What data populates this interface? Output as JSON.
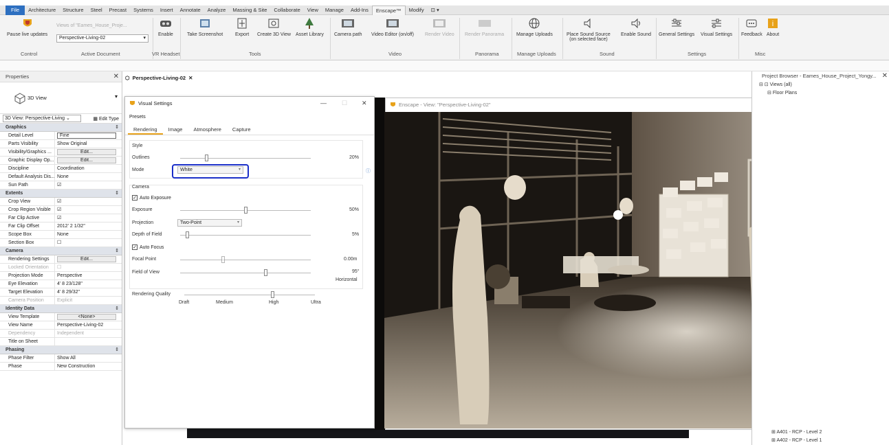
{
  "menu_tabs": [
    "File",
    "Architecture",
    "Structure",
    "Steel",
    "Precast",
    "Systems",
    "Insert",
    "Annotate",
    "Analyze",
    "Massing & Site",
    "Collaborate",
    "View",
    "Manage",
    "Add-Ins",
    "Enscape™",
    "Modify",
    "⊡ ▾"
  ],
  "ribbon": {
    "pause_live": "Pause live updates",
    "doc_hint": "Views of \"Eames_House_Proje...",
    "doc_select": "Perspective-Living-02",
    "enable": "Enable",
    "take_screenshot": "Take Screenshot",
    "export": "Export",
    "create3d": "Create 3D View",
    "asset_library": "Asset Library",
    "camera_path": "Camera path",
    "video_editor": "Video Editor (on/off)",
    "render_video": "Render Video",
    "render_panorama": "Render Panorama",
    "manage_uploads": "Manage Uploads",
    "place_sound": "Place Sound Source",
    "place_sound_sub": "(on selected face)",
    "enable_sound": "Enable Sound",
    "general_settings": "General Settings",
    "visual_settings": "Visual Settings",
    "feedback": "Feedback",
    "about": "About",
    "groups": {
      "control": "Control",
      "active_doc": "Active Document",
      "vr": "VR Headset",
      "tools": "Tools",
      "video": "Video",
      "panorama": "Panorama",
      "manage_uploads": "Manage Uploads",
      "sound": "Sound",
      "settings": "Settings",
      "misc": "Misc"
    }
  },
  "properties": {
    "title": "Properties",
    "type_name": "3D View",
    "view_select": "3D View: Perspective-Living",
    "edit_type": "Edit Type",
    "sections": {
      "graphics": "Graphics",
      "extents": "Extents",
      "camera": "Camera",
      "identity": "Identity Data",
      "phasing": "Phasing"
    },
    "graphics_rows": [
      {
        "k": "Detail Level",
        "v": "Fine"
      },
      {
        "k": "Parts Visibility",
        "v": "Show Original"
      },
      {
        "k": "Visibility/Graphics ...",
        "v": "Edit..."
      },
      {
        "k": "Graphic Display Op...",
        "v": "Edit..."
      },
      {
        "k": "Discipline",
        "v": "Coordination"
      },
      {
        "k": "Default Analysis Dis...",
        "v": "None"
      },
      {
        "k": "Sun Path",
        "v": "☑"
      }
    ],
    "extents_rows": [
      {
        "k": "Crop View",
        "v": "☑"
      },
      {
        "k": "Crop Region Visible",
        "v": "☑"
      },
      {
        "k": "Far Clip Active",
        "v": "☑"
      },
      {
        "k": "Far Clip Offset",
        "v": "2012'  2 1/32\""
      },
      {
        "k": "Scope Box",
        "v": "None"
      },
      {
        "k": "Section Box",
        "v": "☐"
      }
    ],
    "camera_rows": [
      {
        "k": "Rendering Settings",
        "v": "Edit..."
      },
      {
        "k": "Locked Orientation",
        "v": "☐"
      },
      {
        "k": "Projection Mode",
        "v": "Perspective"
      },
      {
        "k": "Eye Elevation",
        "v": "4'  8 23/128\""
      },
      {
        "k": "Target Elevation",
        "v": "4'  8 29/32\""
      },
      {
        "k": "Camera Position",
        "v": "Explicit"
      }
    ],
    "identity_rows": [
      {
        "k": "View Template",
        "v": "<None>"
      },
      {
        "k": "View Name",
        "v": "Perspective-Living-02"
      },
      {
        "k": "Dependency",
        "v": "Independent"
      },
      {
        "k": "Title on Sheet",
        "v": ""
      }
    ],
    "phasing_rows": [
      {
        "k": "Phase Filter",
        "v": "Show All"
      },
      {
        "k": "Phase",
        "v": "New Construction"
      }
    ]
  },
  "doc_tab": "Perspective-Living-02",
  "visual_settings": {
    "title": "Visual Settings",
    "presets": "Presets",
    "tabs": [
      "Rendering",
      "Image",
      "Atmosphere",
      "Capture"
    ],
    "style": "Style",
    "outlines": "Outlines",
    "outlines_val": "20%",
    "outlines_pct": 20,
    "mode": "Mode",
    "mode_val": "White",
    "camera": "Camera",
    "auto_exposure": "Auto Exposure",
    "exposure": "Exposure",
    "exposure_val": "50%",
    "exposure_pct": 50,
    "projection": "Projection",
    "projection_val": "Two-Point",
    "dof": "Depth of Field",
    "dof_val": "5%",
    "dof_pct": 5,
    "auto_focus": "Auto Focus",
    "focal_point": "Focal Point",
    "focal_val": "0.00m",
    "fov": "Field of View",
    "fov_val": "95°",
    "fov_sub": "Horizontal",
    "quality": "Rendering Quality",
    "quality_levels": [
      "Draft",
      "Medium",
      "High",
      "Ultra"
    ]
  },
  "enscape_window": {
    "title": "Enscape - View: \"Perspective-Living-02\""
  },
  "project_browser": {
    "title": "Project Browser - Eames_House_Project_Yongy...",
    "items": [
      "Views (all)",
      "Floor Plans"
    ],
    "bottom_items": [
      "A401 - RCP - Level 2",
      "A402 - RCP - Level 1"
    ]
  },
  "colors": {
    "accent": "#e8a21a",
    "file_blue": "#2d6fc0",
    "highlight": "#1a2ec8"
  }
}
